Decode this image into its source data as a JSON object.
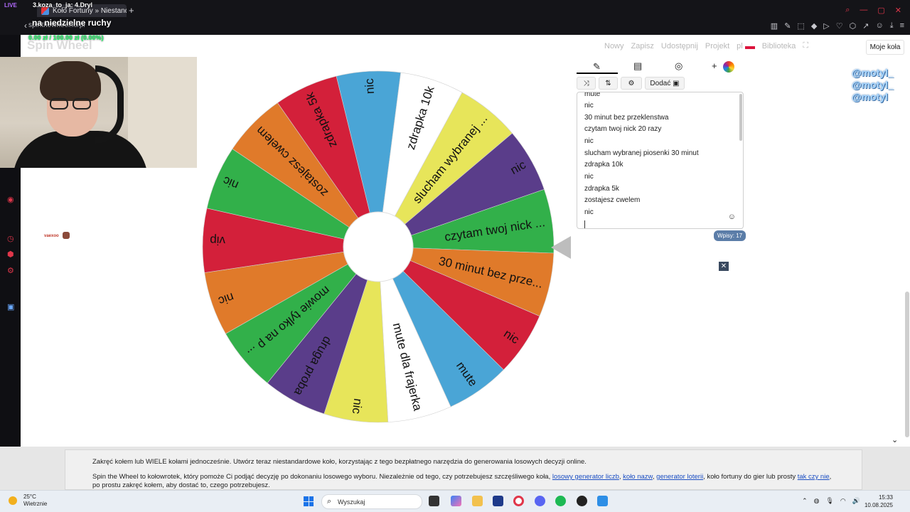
{
  "browser": {
    "tab_title": "Koło Fortuny » Niestandar",
    "address": "spinthewheel.io/pl"
  },
  "overlay": {
    "live_label": "LIVE",
    "ticker": "3.koza_to_ja:           4.Dryl",
    "headline": "na niedzielne ruchy",
    "numbers": "0.00 zł / 100.00 zł (0.00%)",
    "vaexoo": "vaexoo",
    "socials": [
      "@motyl_",
      "@motyl_",
      "@motyl"
    ]
  },
  "site": {
    "logo": "Spin Wheel",
    "nav": [
      "Nowy",
      "Zapisz",
      "Udostępnij",
      "Projekt",
      "pl",
      "Biblioteka"
    ],
    "my_wheels": "Moje koła"
  },
  "wheel": {
    "segments": [
      {
        "label": "czytam twoj nick ...",
        "color": "#32b04a"
      },
      {
        "label": "30 minut bez prze...",
        "color": "#e07a2a"
      },
      {
        "label": "nic",
        "color": "#d3203a"
      },
      {
        "label": "mute",
        "color": "#4aa5d6"
      },
      {
        "label": "mute dla frajerka",
        "color": "#ffffff"
      },
      {
        "label": "nic",
        "color": "#e7e55a"
      },
      {
        "label": "druga proba",
        "color": "#5a3d8a"
      },
      {
        "label": "mowie tylko na p ...",
        "color": "#32b04a"
      },
      {
        "label": "nic",
        "color": "#e07a2a"
      },
      {
        "label": "vip",
        "color": "#d3203a"
      },
      {
        "label": "nic",
        "color": "#32b04a"
      },
      {
        "label": "zostajesz cwelem",
        "color": "#e07a2a"
      },
      {
        "label": "zdrapka 5k",
        "color": "#d3203a"
      },
      {
        "label": "nic",
        "color": "#4aa5d6"
      },
      {
        "label": "zdrapka 10k",
        "color": "#ffffff"
      },
      {
        "label": "slucham wybranej ...",
        "color": "#e7e55a"
      },
      {
        "label": "nic",
        "color": "#5a3d8a"
      }
    ]
  },
  "editor": {
    "add_button": "Dodać",
    "entries": [
      "mute",
      "nic",
      "30 minut bez przeklenstwa",
      "czytam twoj nick 20 razy",
      "nic",
      "slucham wybranej piosenki 30 minut",
      "zdrapka 10k",
      "nic",
      "zdrapka 5k",
      "zostajesz cwelem",
      "nic"
    ],
    "count_label": "Wpisy: 17"
  },
  "info": {
    "line1": "Zakręć kołem lub WIELE kołami jednocześnie. Utwórz teraz niestandardowe koło, korzystając z tego bezpłatnego narzędzia do generowania losowych decyzji online.",
    "line2_a": "Spin the Wheel to kołowrotek, który pomoże Ci podjąć decyzję po dokonaniu losowego wyboru. Niezależnie od tego, czy potrzebujesz szczęśliwego koła, ",
    "link1": "losowy generator liczb",
    "sep1": ", ",
    "link2": "koło nazw",
    "sep2": ", ",
    "link3": "generator loterii",
    "line2_b": ", koło fortuny do gier lub prosty ",
    "link4": "tak czy nie",
    "line2_c": ", po prostu zakręć kołem, aby dostać to, czego potrzebujesz."
  },
  "taskbar": {
    "temp": "25°C",
    "weather": "Wietrznie",
    "search_placeholder": "Wyszukaj",
    "time": "15:33",
    "date": "10.08.2025"
  }
}
